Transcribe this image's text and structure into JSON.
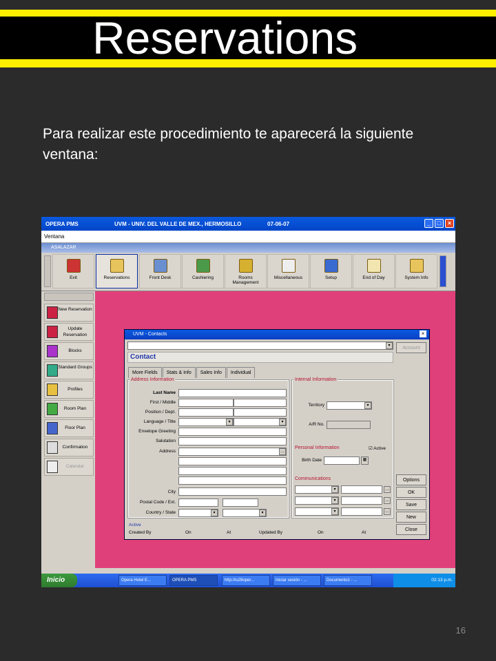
{
  "slide": {
    "title": "Reservations",
    "intro": "Para realizar este procedimiento te aparecerá la siguiente ventana:",
    "page_number": "16",
    "colors": {
      "band": "#ffef00",
      "background": "#2b2b2b"
    }
  },
  "app": {
    "title_left": "OPERA PMS",
    "title_center": "UVM - UNIV. DEL VALLE DE MEX., HERMOSILLO",
    "date": "07-06-07",
    "menu": "Ventana",
    "subtitle": "ASALAZAR",
    "toolbar": [
      "Exit",
      "Reservations",
      "Front Desk",
      "Cashiering",
      "Rooms Management",
      "Miscellaneous",
      "Setup",
      "End of Day",
      "System Info"
    ],
    "sidebar": [
      "New Reservation",
      "Update Reservation",
      "Blocks",
      "Standard Groups",
      "Profiles",
      "Room Plan",
      "Floor Plan",
      "Confirmation",
      "Calendar"
    ],
    "dialog": {
      "title": "UVM - Contacts",
      "header": "Contact",
      "tabs": [
        "More Fields",
        "Stats & Info",
        "Sales Info",
        "Individual"
      ],
      "address_group": "Address Information",
      "address_labels": [
        "Last Name",
        "First / Middle",
        "Position / Dept.",
        "Language / Title",
        "Envelope Greeting",
        "Salutation",
        "Address",
        "City",
        "Postal Code / Ext.",
        "Country / State"
      ],
      "internal_group": "Internal Information",
      "territory": "Territory",
      "ar_no": "A/R No.",
      "personal_group": "Personal Information",
      "active_chk": "Active",
      "birth_date": "Birth Date",
      "comm_group": "Communications",
      "buttons": [
        "Options",
        "OK",
        "Save",
        "New",
        "Close"
      ],
      "account_btn": "Account",
      "footer": {
        "status": "Active",
        "created_by": "Created By",
        "on1": "On",
        "at1": "At",
        "updated_by": "Updated By",
        "on2": "On",
        "at2": "At"
      }
    },
    "taskbar": {
      "start": "Inicio",
      "tasks": [
        "Opera Hotel E...",
        "OPERA PMS",
        "http://iu28oper...",
        "Iniciar sesión - ...",
        "Documento1 - ..."
      ],
      "clock": "02:13 p.m."
    }
  }
}
